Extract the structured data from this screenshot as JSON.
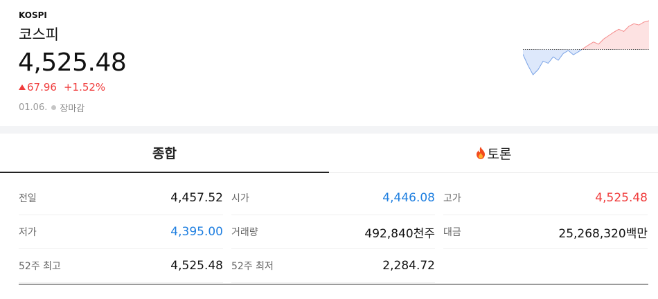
{
  "index": {
    "code": "KOSPI",
    "name": "코스피",
    "price": "4,525.48",
    "change": "67.96",
    "change_pct": "+1.52%",
    "date": "01.06.",
    "market_status": "장마감",
    "direction": "up"
  },
  "colors": {
    "up": "#f03b3b",
    "down": "#1f7fe0",
    "sparkline_up_fill": "#fde2e2",
    "sparkline_down_fill": "#dde8fb"
  },
  "sparkline": {
    "baseline": 4457.52,
    "values": [
      4446,
      4420,
      4398,
      4410,
      4430,
      4425,
      4440,
      4432,
      4448,
      4455,
      4445,
      4452,
      4460,
      4468,
      4475,
      4470,
      4482,
      4490,
      4498,
      4505,
      4500,
      4512,
      4518,
      4515,
      4522,
      4525
    ]
  },
  "tabs": [
    {
      "label": "종합",
      "active": true
    },
    {
      "label": "토론",
      "active": false,
      "icon": "fire-icon"
    }
  ],
  "stats": [
    {
      "label": "전일",
      "value": "4,457.52",
      "color": "neutral"
    },
    {
      "label": "시가",
      "value": "4,446.08",
      "color": "down"
    },
    {
      "label": "고가",
      "value": "4,525.48",
      "color": "up"
    },
    {
      "label": "저가",
      "value": "4,395.00",
      "color": "down"
    },
    {
      "label": "거래량",
      "value": "492,840천주",
      "color": "neutral"
    },
    {
      "label": "대금",
      "value": "25,268,320백만",
      "color": "neutral"
    },
    {
      "label": "52주 최고",
      "value": "4,525.48",
      "color": "neutral"
    },
    {
      "label": "52주 최저",
      "value": "2,284.72",
      "color": "neutral"
    }
  ]
}
